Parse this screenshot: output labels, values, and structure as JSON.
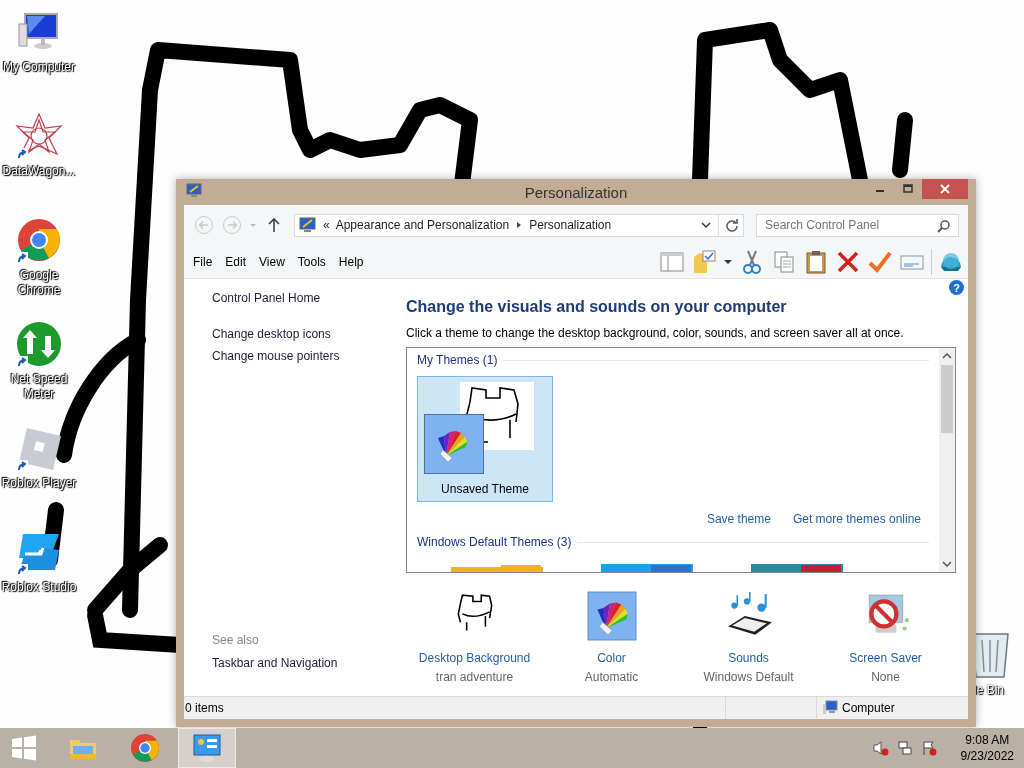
{
  "desktop_icons": [
    {
      "kind": "computer",
      "label": "My Computer",
      "shortcut": false
    },
    {
      "kind": "star",
      "label": "DataWagon...",
      "shortcut": true
    },
    {
      "kind": "chrome",
      "label": "Google Chrome",
      "shortcut": true
    },
    {
      "kind": "netspeed",
      "label": "Net Speed Meter",
      "shortcut": true
    },
    {
      "kind": "roblox-player",
      "label": "Roblox Player",
      "shortcut": true
    },
    {
      "kind": "roblox-studio",
      "label": "Roblox Studio",
      "shortcut": true
    }
  ],
  "recycle_bin": {
    "label": "le Bin"
  },
  "window": {
    "title": "Personalization",
    "address": {
      "overflow": "«",
      "crumbs": [
        "Appearance and Personalization",
        "Personalization"
      ]
    },
    "search": {
      "placeholder": "Search Control Panel"
    },
    "menu": [
      "File",
      "Edit",
      "View",
      "Tools",
      "Help"
    ],
    "help": "?",
    "sidebar": {
      "links": [
        "Control Panel Home",
        "Change desktop icons",
        "Change mouse pointers"
      ],
      "see_also_title": "See also",
      "see_also": [
        "Taskbar and Navigation"
      ]
    },
    "heading": "Change the visuals and sounds on your computer",
    "subtitle": "Click a theme to change the desktop background, color, sounds, and screen saver all at once.",
    "theme_groups": [
      {
        "title": "My Themes (1)",
        "themes": [
          {
            "kind": "custom",
            "name": "Unsaved Theme",
            "selected": true
          }
        ],
        "actions": [
          "Save theme",
          "Get more themes online"
        ]
      },
      {
        "title": "Windows Default Themes (3)"
      }
    ],
    "settings": [
      {
        "kind": "background",
        "label": "Desktop Background",
        "value": "tran adventure"
      },
      {
        "kind": "color",
        "label": "Color",
        "value": "Automatic"
      },
      {
        "kind": "sounds",
        "label": "Sounds",
        "value": "Windows Default"
      },
      {
        "kind": "screensaver",
        "label": "Screen Saver",
        "value": "None"
      }
    ],
    "status_bar": {
      "items": "0 items",
      "location": "Computer"
    }
  },
  "taskbar": {
    "apps": [
      {
        "kind": "explorer",
        "selected": false
      },
      {
        "kind": "chrome",
        "selected": false
      },
      {
        "kind": "control-panel",
        "selected": true
      }
    ],
    "clock": {
      "time": "9:08 AM",
      "date": "9/23/2022"
    }
  }
}
